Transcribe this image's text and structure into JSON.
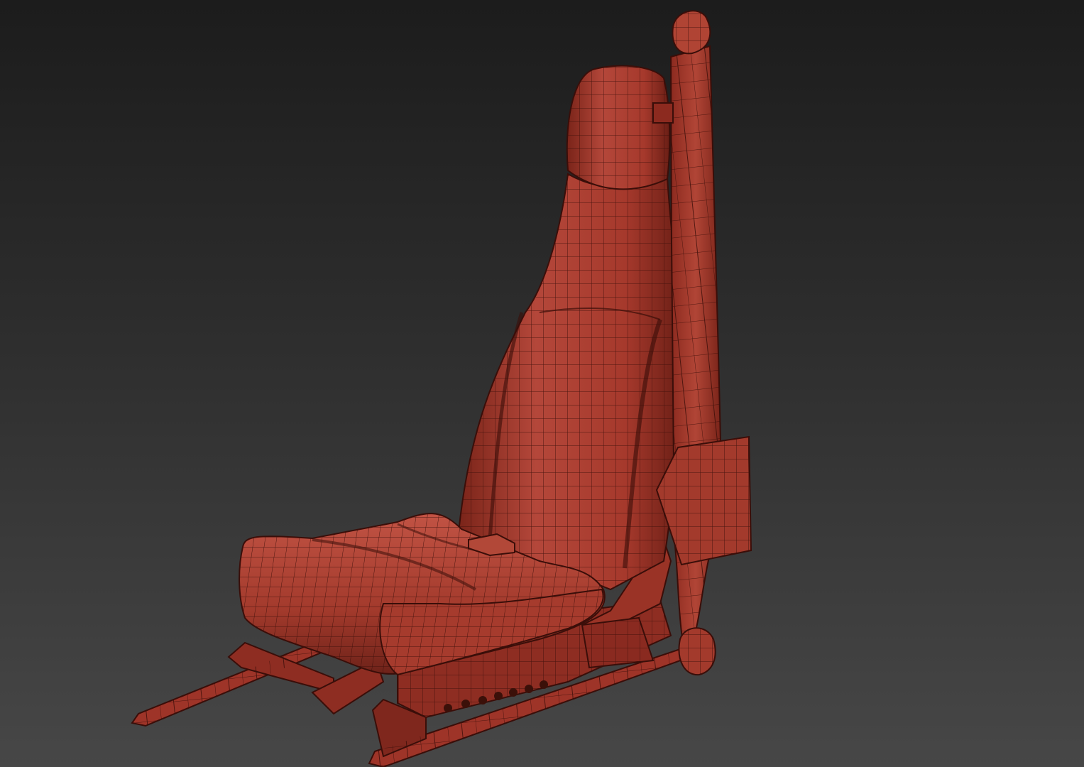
{
  "viewport": {
    "background_top": "#1c1c1c",
    "background_bottom": "#474747",
    "shading_mode": "wireframe-on-shaded",
    "model_name": "car-seat"
  },
  "model": {
    "base_color": "#a33a2c",
    "highlight_color": "#c95a48",
    "shadow_color": "#5e1d15",
    "wire_color": "#3a0e09",
    "parts": [
      "headrest",
      "backrest",
      "seat-cushion",
      "seatbelt-strap",
      "seatbelt-anchor-top",
      "seatbelt-buckle-plate",
      "seatbelt-latch",
      "side-trim",
      "seat-rails"
    ]
  }
}
